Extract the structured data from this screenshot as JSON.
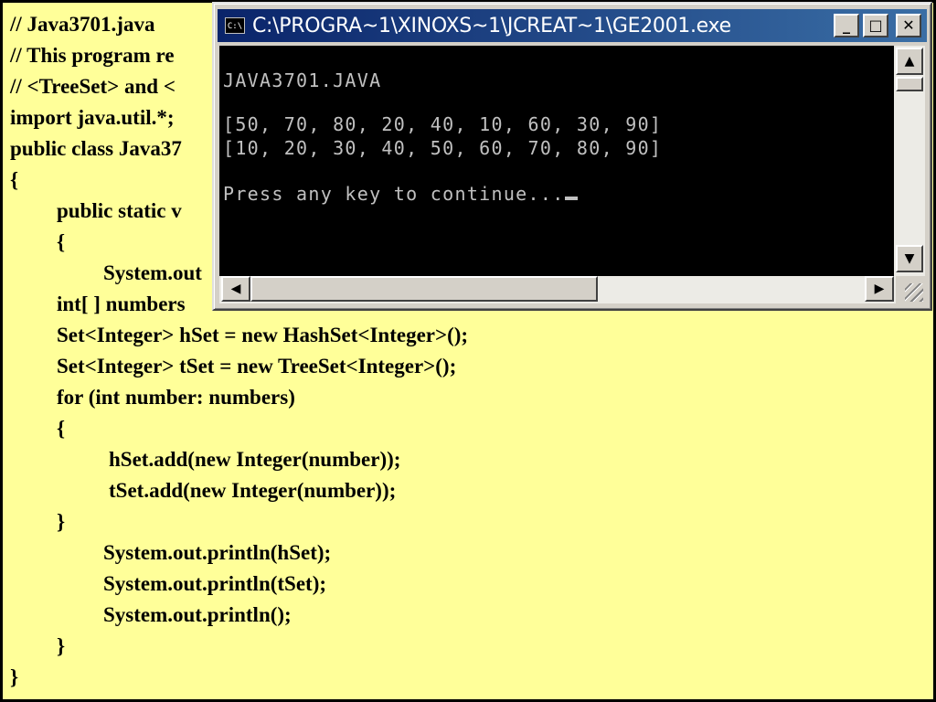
{
  "code": {
    "lines": [
      "// Java3701.java",
      "// This program re",
      "// <TreeSet> and <",
      "import java.util.*;",
      "public class Java37",
      "{",
      "public static v",
      "{",
      "System.out",
      "int[ ] numbers",
      "Set<Integer> hSet = new HashSet<Integer>();",
      "Set<Integer> tSet = new TreeSet<Integer>();",
      "for (int number: numbers)",
      "{",
      "hSet.add(new Integer(number));",
      "tSet.add(new Integer(number));",
      "}",
      "System.out.println(hSet);",
      "System.out.println(tSet);",
      "System.out.println();",
      "}",
      "}"
    ]
  },
  "console": {
    "title": "C:\\PROGRA~1\\XINOXS~1\\JCREAT~1\\GE2001.exe",
    "icon_label": "C:\\",
    "buttons": {
      "minimize": "_",
      "maximize": "□",
      "close": "✕"
    },
    "output": [
      "JAVA3701.JAVA",
      "[50, 70, 80, 20, 40, 10, 60, 30, 90]",
      "[10, 20, 30, 40, 50, 60, 70, 80, 90]",
      "Press any key to continue..."
    ],
    "scroll_icons": {
      "up": "▲",
      "down": "▼",
      "left": "◀",
      "right": "▶"
    }
  }
}
